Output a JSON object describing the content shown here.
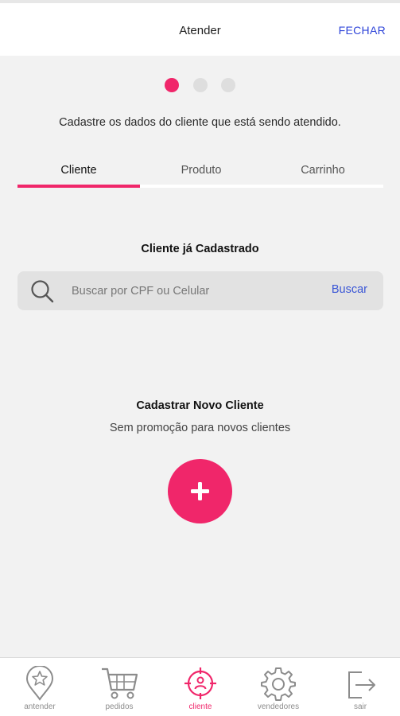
{
  "header": {
    "title": "Atender",
    "close_label": "FECHAR"
  },
  "stepper": {
    "total": 3,
    "current": 1
  },
  "instruction": "Cadastre os dados do cliente que está sendo atendido.",
  "tabs": [
    {
      "label": "Cliente",
      "active": true
    },
    {
      "label": "Produto",
      "active": false
    },
    {
      "label": "Carrinho",
      "active": false
    }
  ],
  "existing_client": {
    "title": "Cliente já Cadastrado",
    "search_placeholder": "Buscar por CPF ou Celular",
    "search_value": "",
    "search_button": "Buscar",
    "icon": "search-icon"
  },
  "new_client": {
    "title": "Cadastrar Novo Cliente",
    "subtitle": "Sem promoção para novos clientes",
    "add_icon": "plus-icon"
  },
  "bottom_nav": [
    {
      "label": "antender",
      "icon": "star-pin-icon",
      "active": false
    },
    {
      "label": "pedidos",
      "icon": "cart-icon",
      "active": false
    },
    {
      "label": "cliente",
      "icon": "target-person-icon",
      "active": true
    },
    {
      "label": "vendedores",
      "icon": "gear-icon",
      "active": false
    },
    {
      "label": "sair",
      "icon": "exit-icon",
      "active": false
    }
  ],
  "colors": {
    "accent": "#f0266a",
    "link": "#2f45d9",
    "background": "#f2f2f2",
    "inactive": "#8c8c8c"
  }
}
